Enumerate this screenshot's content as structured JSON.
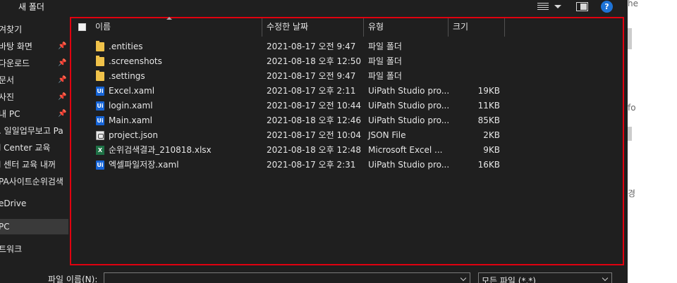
{
  "toolbar": {
    "new_folder_label": "새 폴더",
    "view_icon": "view-options-icon",
    "preview_icon": "preview-pane-icon",
    "help_label": "?"
  },
  "nav": {
    "items": [
      {
        "label": "겨찾기",
        "pinned": false
      },
      {
        "label": "바탕 화면",
        "pinned": true
      },
      {
        "label": "다운로드",
        "pinned": true
      },
      {
        "label": "문서",
        "pinned": true
      },
      {
        "label": "사진",
        "pinned": true
      },
      {
        "label": "내 PC",
        "pinned": true
      },
      {
        "label": ". 일일업무보고 Pa",
        "pinned": false
      },
      {
        "label": "l Center 교육",
        "pinned": false
      },
      {
        "label": "l 센터 교육 내꺼",
        "pinned": false
      },
      {
        "label": "PA사이트순위검색",
        "pinned": false
      },
      {
        "label": "eDrive",
        "pinned": false
      },
      {
        "label": "PC",
        "pinned": false
      },
      {
        "label": "트워크",
        "pinned": false
      }
    ]
  },
  "list": {
    "columns": {
      "name": "이름",
      "date": "수정한 날짜",
      "type": "유형",
      "size": "크기"
    },
    "files": [
      {
        "name": ".entities",
        "date": "2021-08-17 오전 9:47",
        "type": "파일 폴더",
        "size": "",
        "icon": "folder"
      },
      {
        "name": ".screenshots",
        "date": "2021-08-18 오후 12:50",
        "type": "파일 폴더",
        "size": "",
        "icon": "folder"
      },
      {
        "name": ".settings",
        "date": "2021-08-17 오전 9:47",
        "type": "파일 폴더",
        "size": "",
        "icon": "folder"
      },
      {
        "name": "Excel.xaml",
        "date": "2021-08-17 오후 2:11",
        "type": "UiPath Studio pro...",
        "size": "19KB",
        "icon": "uipath"
      },
      {
        "name": "login.xaml",
        "date": "2021-08-17 오전 10:44",
        "type": "UiPath Studio pro...",
        "size": "11KB",
        "icon": "uipath"
      },
      {
        "name": "Main.xaml",
        "date": "2021-08-18 오후 12:46",
        "type": "UiPath Studio pro...",
        "size": "85KB",
        "icon": "uipath"
      },
      {
        "name": "project.json",
        "date": "2021-08-17 오전 10:04",
        "type": "JSON File",
        "size": "2KB",
        "icon": "json"
      },
      {
        "name": "순위검색결과_210818.xlsx",
        "date": "2021-08-18 오후 12:48",
        "type": "Microsoft Excel ...",
        "size": "9KB",
        "icon": "excel"
      },
      {
        "name": "엑셀파일저장.xaml",
        "date": "2021-08-17 오후 2:31",
        "type": "UiPath Studio pro...",
        "size": "16KB",
        "icon": "uipath"
      }
    ]
  },
  "bottom": {
    "filename_label": "파일 이름(N):",
    "filename_value": "",
    "filter_value": "모든 파일 (*.*)"
  },
  "behind": {
    "fragments": [
      "he",
      "fo",
      "경"
    ]
  },
  "colors": {
    "background": "#1f1f1f",
    "highlight_border": "#e0000f",
    "help_blue": "#1e73d6",
    "folder_yellow": "#f0c24a",
    "uipath_blue": "#1665d8",
    "excel_green": "#1e7145"
  }
}
